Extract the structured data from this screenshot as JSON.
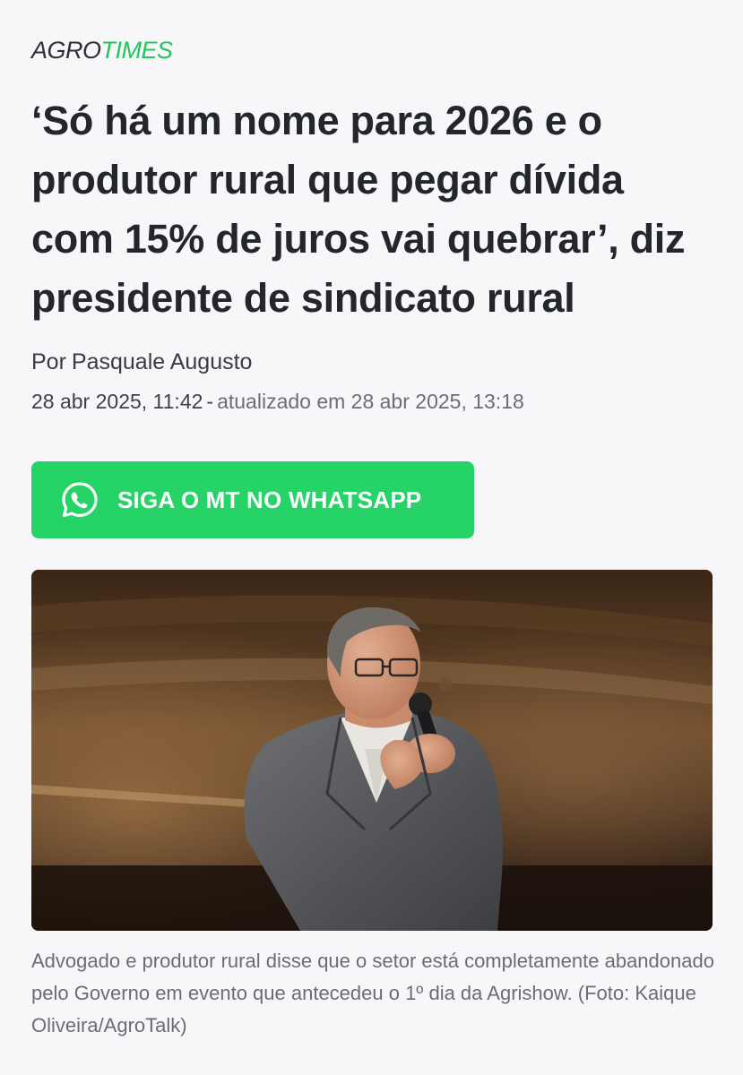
{
  "brand": {
    "part1": "AGRO",
    "part2": "TIMES",
    "accent_color": "#22c55e"
  },
  "article": {
    "headline": "‘Só há um nome para 2026 e o produtor rural que pegar dívida com 15% de juros vai quebrar’, diz presidente de sindicato rural",
    "byline_prefix": "Por",
    "author": "Pasquale Augusto",
    "published": "28 abr 2025, 11:42",
    "separator": "-",
    "updated": "atualizado em 28 abr 2025, 13:18",
    "whatsapp_cta": "SIGA O MT NO WHATSAPP",
    "whatsapp_icon": "whatsapp-icon",
    "whatsapp_color": "#25d366",
    "photo_caption": "Advogado e produtor rural disse que o setor está completamente abandonado pelo Governo em evento que antecedeu o 1º dia da Agrishow. (Foto: Kaique Oliveira/AgroTalk)"
  }
}
